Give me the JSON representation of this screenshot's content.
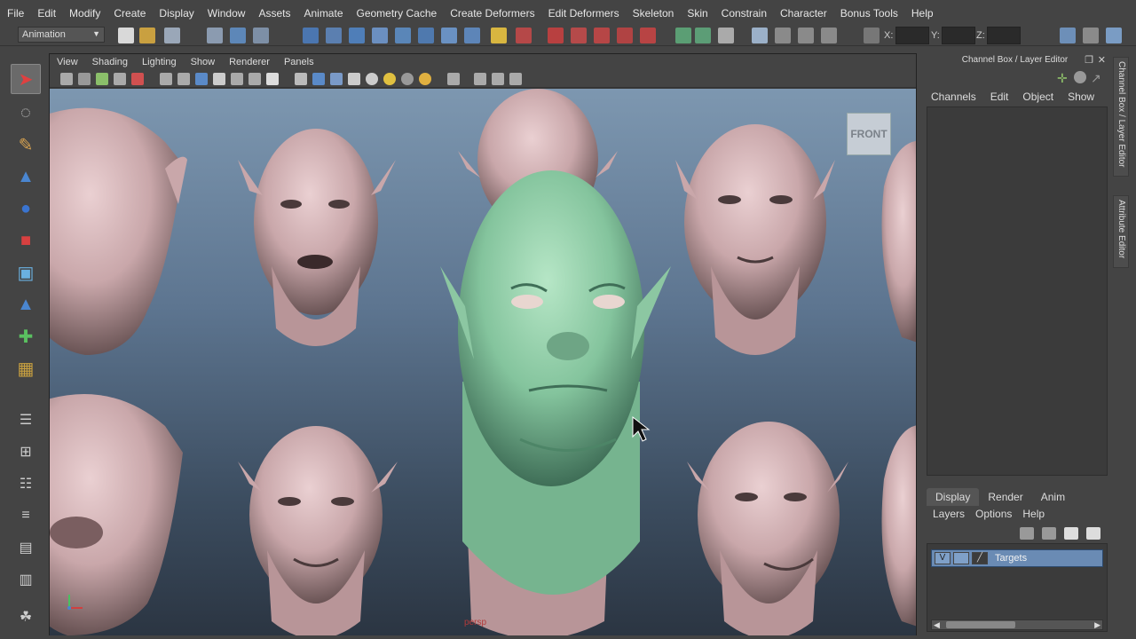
{
  "menu": [
    "File",
    "Edit",
    "Modify",
    "Create",
    "Display",
    "Window",
    "Assets",
    "Animate",
    "Geometry Cache",
    "Create Deformers",
    "Edit Deformers",
    "Skeleton",
    "Skin",
    "Constrain",
    "Character",
    "Bonus Tools",
    "Help"
  ],
  "mode": "Animation",
  "coords": {
    "x": "X:",
    "y": "Y:",
    "z": "Z:"
  },
  "viewport": {
    "menu": [
      "View",
      "Shading",
      "Lighting",
      "Show",
      "Renderer",
      "Panels"
    ],
    "camera_label": "FRONT",
    "camera_name": "persp"
  },
  "channelbox": {
    "title": "Channel Box / Layer Editor",
    "menu": [
      "Channels",
      "Edit",
      "Object",
      "Show"
    ]
  },
  "layers": {
    "tabs": [
      "Display",
      "Render",
      "Anim"
    ],
    "menu": [
      "Layers",
      "Options",
      "Help"
    ],
    "rows": [
      {
        "vis": "V",
        "name": "Targets"
      }
    ]
  },
  "side_tabs": [
    "Channel Box / Layer Editor",
    "Attribute Editor"
  ],
  "colors": {
    "head": "#cfb0b2",
    "active_head": "#8ec8a6",
    "accent": "#6a8bb4"
  }
}
